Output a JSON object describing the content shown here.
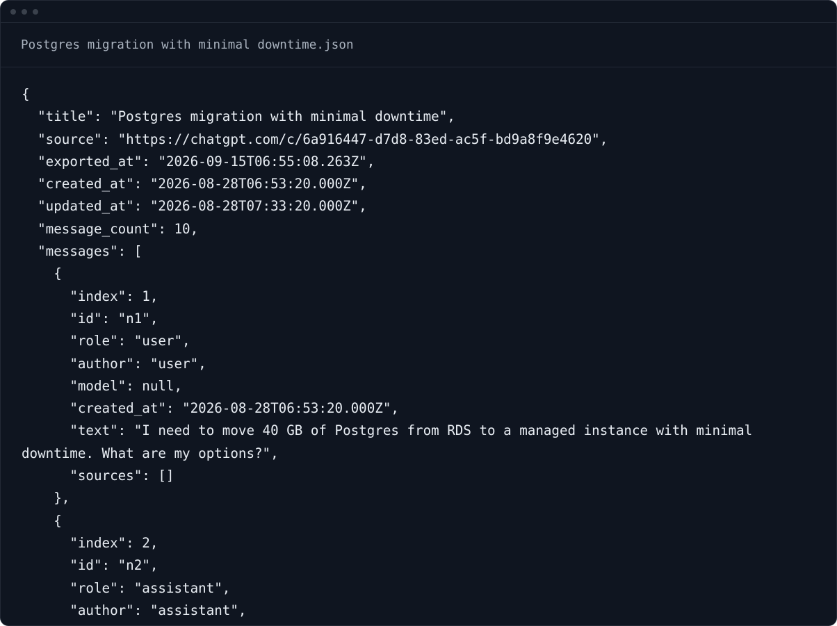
{
  "window": {
    "filename": "Postgres migration with minimal downtime.json"
  },
  "content": {
    "lines": [
      "{",
      "  \"title\": \"Postgres migration with minimal downtime\",",
      "  \"source\": \"https://chatgpt.com/c/6a916447-d7d8-83ed-ac5f-bd9a8f9e4620\",",
      "  \"exported_at\": \"2026-09-15T06:55:08.263Z\",",
      "  \"created_at\": \"2026-08-28T06:53:20.000Z\",",
      "  \"updated_at\": \"2026-08-28T07:33:20.000Z\",",
      "  \"message_count\": 10,",
      "  \"messages\": [",
      "    {",
      "      \"index\": 1,",
      "      \"id\": \"n1\",",
      "      \"role\": \"user\",",
      "      \"author\": \"user\",",
      "      \"model\": null,",
      "      \"created_at\": \"2026-08-28T06:53:20.000Z\",",
      "      \"text\": \"I need to move 40 GB of Postgres from RDS to a managed instance with minimal downtime. What are my options?\",",
      "      \"sources\": []",
      "    },",
      "    {",
      "      \"index\": 2,",
      "      \"id\": \"n2\",",
      "      \"role\": \"assistant\",",
      "      \"author\": \"assistant\","
    ]
  }
}
